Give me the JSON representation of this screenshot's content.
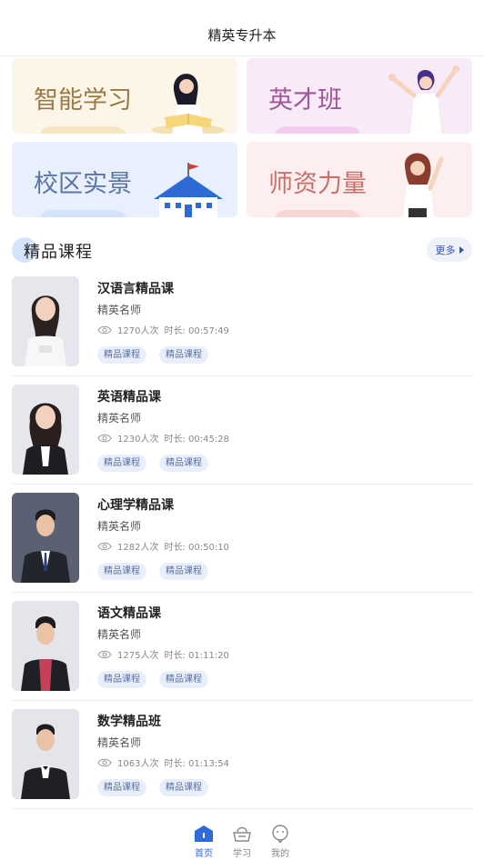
{
  "header": {
    "title": "精英专升本"
  },
  "cards": [
    {
      "label": "智能学习",
      "icon": "student-reading-illustration"
    },
    {
      "label": "英才班",
      "icon": "cheering-student-illustration"
    },
    {
      "label": "校区实景",
      "icon": "school-building-illustration"
    },
    {
      "label": "师资力量",
      "icon": "teacher-illustration"
    }
  ],
  "section": {
    "title": "精品课程",
    "more": "更多"
  },
  "courses": [
    {
      "title": "汉语言精品课",
      "teacher": "精英名师",
      "views": "1270人次",
      "duration": "时长: 00:57:49",
      "tags": [
        "精品课程",
        "精品课程"
      ]
    },
    {
      "title": "英语精品课",
      "teacher": "精英名师",
      "views": "1230人次",
      "duration": "时长: 00:45:28",
      "tags": [
        "精品课程",
        "精品课程"
      ]
    },
    {
      "title": "心理学精品课",
      "teacher": "精英名师",
      "views": "1282人次",
      "duration": "时长: 00:50:10",
      "tags": [
        "精品课程",
        "精品课程"
      ]
    },
    {
      "title": "语文精品课",
      "teacher": "精英名师",
      "views": "1275人次",
      "duration": "时长: 01:11:20",
      "tags": [
        "精品课程",
        "精品课程"
      ]
    },
    {
      "title": "数学精品班",
      "teacher": "精英名师",
      "views": "1063人次",
      "duration": "时长: 01:13:54",
      "tags": [
        "精品课程",
        "精品课程"
      ]
    }
  ],
  "tabbar": {
    "home": "首页",
    "study": "学习",
    "mine": "我的"
  },
  "colors": {
    "accent": "#2e6bd8"
  }
}
